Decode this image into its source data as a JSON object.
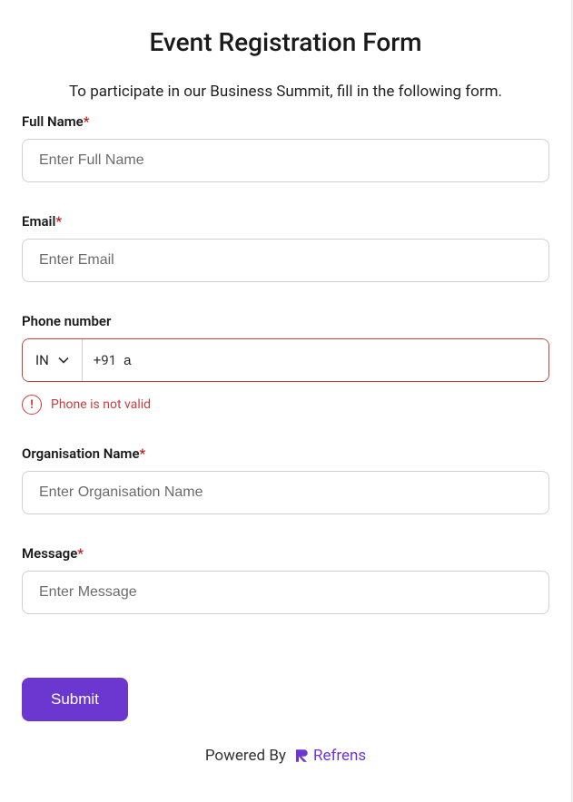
{
  "form": {
    "title": "Event Registration Form",
    "subtitle": "To participate in our Business Summit, fill in the following form.",
    "fields": {
      "fullName": {
        "label": "Full Name",
        "placeholder": "Enter Full Name"
      },
      "email": {
        "label": "Email",
        "placeholder": "Enter Email"
      },
      "phone": {
        "label": "Phone number",
        "countryCode": "IN",
        "dialPrefix": "+91",
        "value": "a",
        "error": "Phone is not valid"
      },
      "organisation": {
        "label": "Organisation Name",
        "placeholder": "Enter Organisation Name"
      },
      "message": {
        "label": "Message",
        "placeholder": "Enter Message"
      }
    },
    "submitLabel": "Submit"
  },
  "footer": {
    "poweredBy": "Powered By",
    "brand": "Refrens"
  }
}
